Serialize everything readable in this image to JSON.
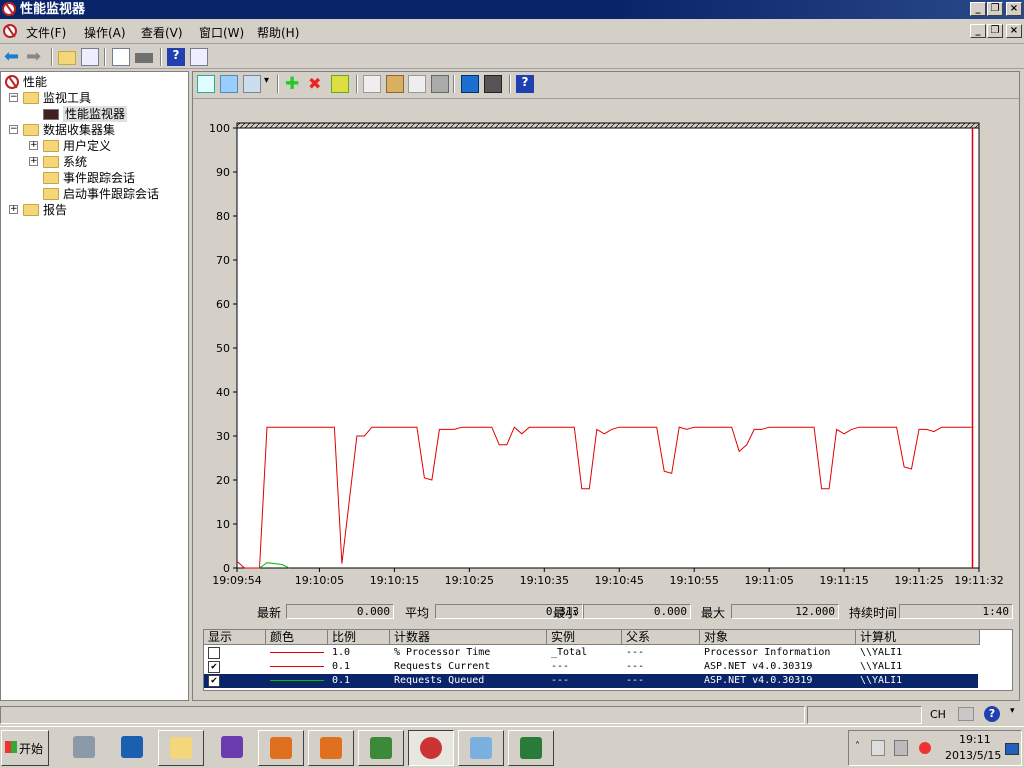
{
  "window": {
    "title": "性能监视器"
  },
  "menu": [
    "文件(F)",
    "操作(A)",
    "查看(V)",
    "窗口(W)",
    "帮助(H)"
  ],
  "tree": {
    "items": [
      {
        "label": "性能",
        "level": 0,
        "expander": ""
      },
      {
        "label": "监视工具",
        "level": 1,
        "expander": "−"
      },
      {
        "label": "性能监视器",
        "level": 2,
        "expander": "",
        "selected": true
      },
      {
        "label": "数据收集器集",
        "level": 1,
        "expander": "−"
      },
      {
        "label": "用户定义",
        "level": 2,
        "expander": "+"
      },
      {
        "label": "系统",
        "level": 2,
        "expander": "+"
      },
      {
        "label": "事件跟踪会话",
        "level": 2,
        "expander": ""
      },
      {
        "label": "启动事件跟踪会话",
        "level": 2,
        "expander": ""
      },
      {
        "label": "报告",
        "level": 1,
        "expander": "+"
      }
    ]
  },
  "graph_toolbar": [
    "change-graph-type-icon",
    "view-log-data-icon",
    "change-view-icon",
    "dropdown-arrow-icon",
    "add-counter-icon",
    "delete-counter-icon",
    "highlight-icon",
    "copy-properties-icon",
    "paste-counter-list-icon",
    "properties-icon",
    "zoom-icon",
    "freeze-display-icon",
    "update-data-icon",
    "help-icon"
  ],
  "chart_data": {
    "type": "line",
    "ylim": [
      0,
      100
    ],
    "yticks": [
      "0",
      "10",
      "20",
      "30",
      "40",
      "50",
      "60",
      "70",
      "80",
      "90",
      "100"
    ],
    "xticks": [
      "19:09:54",
      "19:10:05",
      "19:10:15",
      "19:10:25",
      "19:10:35",
      "19:10:45",
      "19:10:55",
      "19:11:05",
      "19:11:15",
      "19:11:25",
      "19:11:32"
    ],
    "xlim": [
      "19:09:54",
      "19:11:33"
    ],
    "grid": false,
    "series": [
      {
        "name": "Requests Current",
        "color": "#e00000",
        "points": [
          [
            "19:09:54",
            1.5
          ],
          [
            "19:09:55",
            0
          ],
          [
            "19:09:57",
            0
          ],
          [
            "19:09:58",
            32
          ],
          [
            "19:10:07",
            32
          ],
          [
            "19:10:08",
            1
          ],
          [
            "19:10:10",
            30
          ],
          [
            "19:10:11",
            30
          ],
          [
            "19:10:12",
            32
          ],
          [
            "19:10:18",
            32
          ],
          [
            "19:10:19",
            20.5
          ],
          [
            "19:10:20",
            20
          ],
          [
            "19:10:21",
            31.5
          ],
          [
            "19:10:23",
            31.5
          ],
          [
            "19:10:24",
            32
          ],
          [
            "19:10:28",
            32
          ],
          [
            "19:10:29",
            28
          ],
          [
            "19:10:30",
            28
          ],
          [
            "19:10:31",
            32
          ],
          [
            "19:10:32",
            30.5
          ],
          [
            "19:10:33",
            32
          ],
          [
            "19:10:39",
            32
          ],
          [
            "19:10:40",
            18
          ],
          [
            "19:10:41",
            18
          ],
          [
            "19:10:42",
            31.5
          ],
          [
            "19:10:43",
            30.5
          ],
          [
            "19:10:44",
            31.5
          ],
          [
            "19:10:45",
            32
          ],
          [
            "19:10:50",
            32
          ],
          [
            "19:10:51",
            22
          ],
          [
            "19:10:52",
            21.5
          ],
          [
            "19:10:53",
            32
          ],
          [
            "19:10:54",
            31.5
          ],
          [
            "19:10:55",
            32
          ],
          [
            "19:11:00",
            32
          ],
          [
            "19:11:01",
            26.5
          ],
          [
            "19:11:02",
            28
          ],
          [
            "19:11:03",
            31.5
          ],
          [
            "19:11:04",
            31.5
          ],
          [
            "19:11:05",
            32
          ],
          [
            "19:11:11",
            32
          ],
          [
            "19:11:12",
            18
          ],
          [
            "19:11:13",
            18
          ],
          [
            "19:11:14",
            31.5
          ],
          [
            "19:11:15",
            30.5
          ],
          [
            "19:11:16",
            31.5
          ],
          [
            "19:11:17",
            32
          ],
          [
            "19:11:22",
            32
          ],
          [
            "19:11:23",
            23
          ],
          [
            "19:11:24",
            22.5
          ],
          [
            "19:11:25",
            31.5
          ],
          [
            "19:11:26",
            31.5
          ],
          [
            "19:11:27",
            31
          ],
          [
            "19:11:28",
            32
          ],
          [
            "19:11:32",
            32
          ]
        ]
      },
      {
        "name": "Requests Queued",
        "color": "#00c000",
        "points": [
          [
            "19:09:57",
            0
          ],
          [
            "19:09:58",
            1.2
          ],
          [
            "19:10:00",
            0.8
          ],
          [
            "19:10:01",
            0
          ]
        ]
      }
    ],
    "current_time": "19:11:32"
  },
  "stats": [
    {
      "label": "最新",
      "value": "0.000"
    },
    {
      "label": "平均",
      "value": "0.313"
    },
    {
      "label": "最小",
      "value": "0.000"
    },
    {
      "label": "最大",
      "value": "12.000"
    },
    {
      "label": "持续时间",
      "value": "1:40"
    }
  ],
  "counters": {
    "headers": [
      "显示",
      "颜色",
      "比例",
      "计数器",
      "实例",
      "父系",
      "对象",
      "计算机"
    ],
    "rows": [
      {
        "show": false,
        "color": "#e00000",
        "scale": "1.0",
        "counter": "% Processor Time",
        "instance": "_Total",
        "parent": "---",
        "object": "Processor Information",
        "computer": "\\\\YALI1"
      },
      {
        "show": true,
        "color": "#e00000",
        "scale": "0.1",
        "counter": "Requests Current",
        "instance": "---",
        "parent": "---",
        "object": "ASP.NET v4.0.30319",
        "computer": "\\\\YALI1"
      },
      {
        "show": true,
        "color": "#00c000",
        "scale": "0.1",
        "counter": "Requests Queued",
        "instance": "---",
        "parent": "---",
        "object": "ASP.NET v4.0.30319",
        "computer": "\\\\YALI1",
        "selected": true
      }
    ]
  },
  "langbar": {
    "lang": "CH"
  },
  "taskbar": {
    "start": "开始",
    "time": "19:11",
    "date": "2013/5/15"
  }
}
